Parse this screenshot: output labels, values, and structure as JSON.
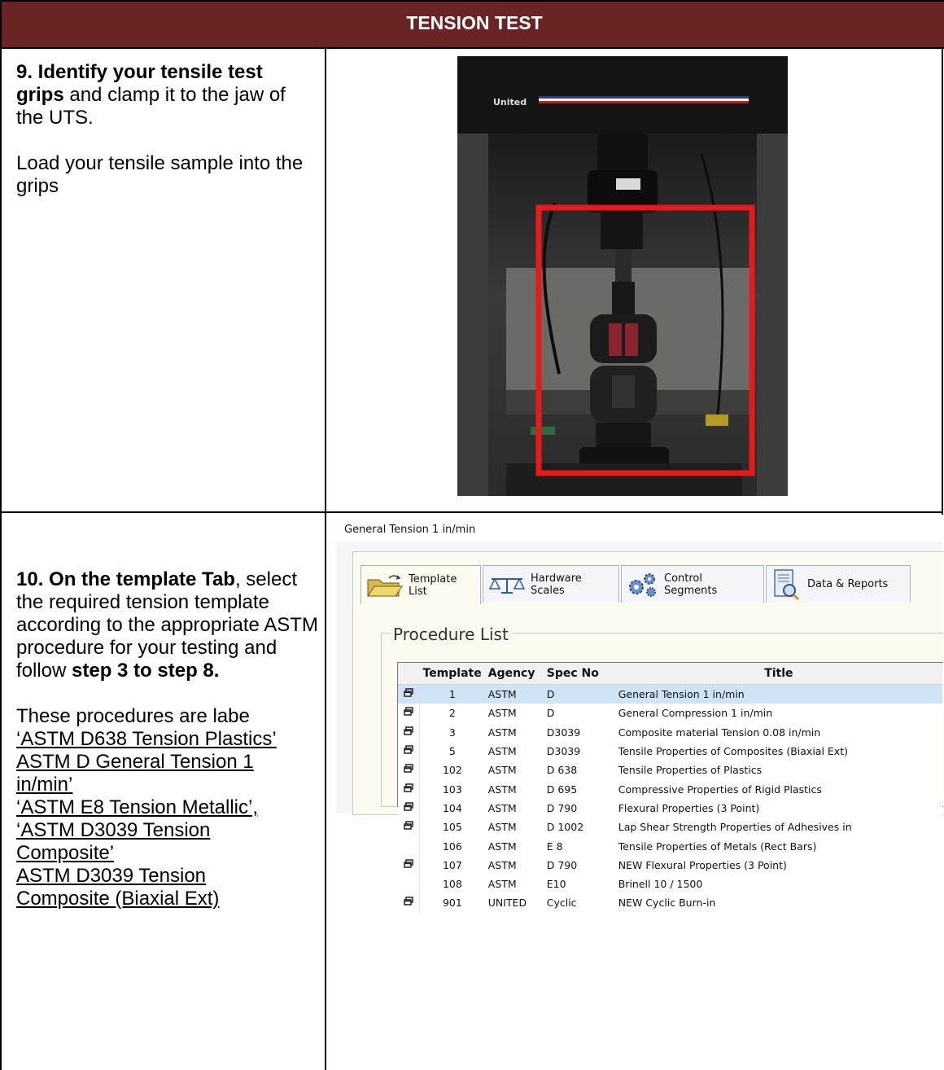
{
  "header": {
    "title": "TENSION TEST"
  },
  "step9": {
    "title": "9. Identify your tensile test grips",
    "rest": " and clamp it to the jaw of the UTS.",
    "second": " Load your tensile sample into the grips",
    "photo_brand": "United"
  },
  "step10": {
    "title": "10. On the template Tab",
    "rest": ", select the required tension template according to the appropriate ASTM procedure for your testing and follow ",
    "bold_tail": "step 3 to step 8.",
    "procedures_intro": "These procedures are labe",
    "procedures": [
      "‘ASTM D638 Tension Plastics’",
      " ASTM D General Tension 1 in/min’",
      "‘ASTM E8 Tension Metallic’,",
      "‘ASTM D3039 Tension Composite’",
      "ASTM D3039 Tension Composite (Biaxial Ext)"
    ]
  },
  "app": {
    "window_title": "General Tension 1 in/min",
    "tabs": [
      {
        "label": "Template List",
        "icon": "folder-open-icon"
      },
      {
        "label": "Hardware Scales",
        "icon": "balance-scale-icon"
      },
      {
        "label": "Control Segments",
        "icon": "gears-icon"
      },
      {
        "label": "Data & Reports",
        "icon": "report-magnifier-icon"
      }
    ],
    "group_label": "Procedure List",
    "columns": [
      "Template",
      "Agency",
      "Spec No",
      "Title"
    ],
    "rows": [
      {
        "template": "1",
        "agency": "ASTM",
        "spec": "D",
        "title": "General Tension 1 in/min",
        "icon": true,
        "selected": true
      },
      {
        "template": "2",
        "agency": "ASTM",
        "spec": "D",
        "title": "General Compression 1 in/min",
        "icon": true
      },
      {
        "template": "3",
        "agency": "ASTM",
        "spec": "D3039",
        "title": "Composite material Tension 0.08 in/min",
        "icon": true
      },
      {
        "template": "5",
        "agency": "ASTM",
        "spec": "D3039",
        "title": "Tensile Properties of Composites (Biaxial Ext)",
        "icon": true
      },
      {
        "template": "102",
        "agency": "ASTM",
        "spec": "D 638",
        "title": "Tensile Properties of Plastics",
        "icon": true
      },
      {
        "template": "103",
        "agency": "ASTM",
        "spec": "D 695",
        "title": "Compressive Properties of Rigid Plastics",
        "icon": true
      },
      {
        "template": "104",
        "agency": "ASTM",
        "spec": "D 790",
        "title": "Flexural Properties (3 Point)",
        "icon": true
      },
      {
        "template": "105",
        "agency": "ASTM",
        "spec": "D 1002",
        "title": "Lap Shear Strength Properties of Adhesives in",
        "icon": true
      },
      {
        "template": "106",
        "agency": "ASTM",
        "spec": "E 8",
        "title": "Tensile Properties of Metals (Rect Bars)",
        "icon": false
      },
      {
        "template": "107",
        "agency": "ASTM",
        "spec": "D 790",
        "title": "NEW Flexural Properties (3 Point)",
        "icon": true
      },
      {
        "template": "108",
        "agency": "ASTM",
        "spec": "E10",
        "title": "Brinell 10 / 1500",
        "icon": false
      },
      {
        "template": "901",
        "agency": "UNITED",
        "spec": "Cyclic",
        "title": "NEW Cyclic Burn-in",
        "icon": true
      }
    ]
  },
  "colors": {
    "header_bg": "#6b2424",
    "highlight_box": "#e8191b",
    "row_selected": "#cfe4f7"
  }
}
